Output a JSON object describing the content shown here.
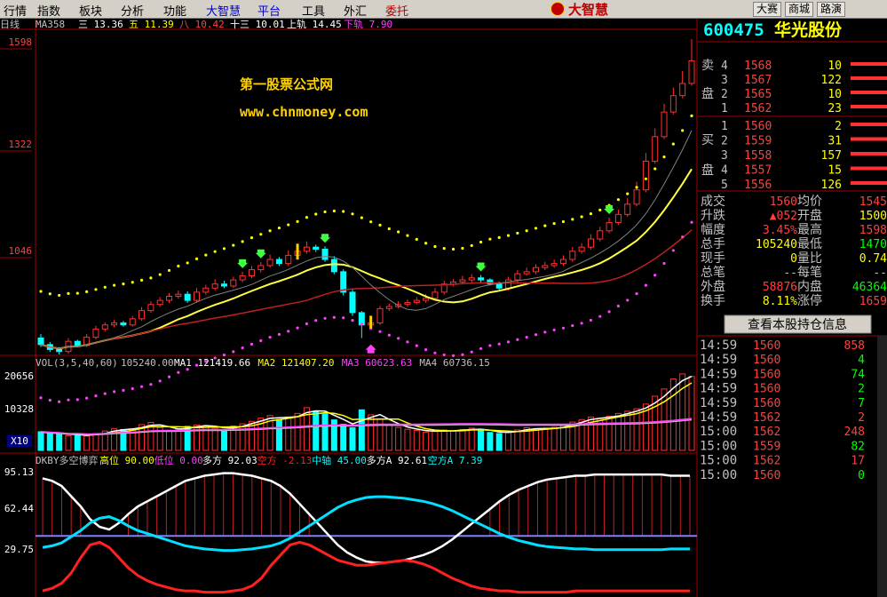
{
  "menu": {
    "items": [
      {
        "label": "行情",
        "x": 0,
        "style": "normal"
      },
      {
        "label": "指数",
        "x": 38,
        "style": "normal"
      },
      {
        "label": "板块",
        "x": 85,
        "style": "normal"
      },
      {
        "label": "分析",
        "x": 132,
        "style": "normal"
      },
      {
        "label": "功能",
        "x": 180,
        "style": "normal"
      },
      {
        "label": "大智慧",
        "x": 228,
        "style": "blue"
      },
      {
        "label": "平台",
        "x": 286,
        "style": "blue"
      },
      {
        "label": "工具",
        "x": 336,
        "style": "normal"
      },
      {
        "label": "外汇",
        "x": 383,
        "style": "normal"
      },
      {
        "label": "委托",
        "x": 430,
        "style": "red"
      }
    ],
    "brand": "大智慧",
    "buttons": [
      "大赛",
      "商城",
      "路演"
    ]
  },
  "chart_header": {
    "period": "日线",
    "ma_title": "MA358",
    "ma_items": [
      {
        "label": "三 13.36",
        "color": "#ffffff"
      },
      {
        "label": "五 11.39",
        "color": "#ffff00"
      },
      {
        "label": "八 10.42",
        "color": "#ff4040"
      },
      {
        "label": "十三 10.01",
        "color": "#ffffff"
      },
      {
        "label": "上轨 14.45",
        "color": "#ffffff"
      },
      {
        "label": "下轨 7.90",
        "color": "#ff40ff"
      }
    ]
  },
  "watermark": {
    "line1": "第一股票公式网",
    "line2": "www.chnmoney.com"
  },
  "price_axis": [
    {
      "label": "1598",
      "y": 47
    },
    {
      "label": "1322",
      "y": 162
    },
    {
      "label": "1046",
      "y": 282
    }
  ],
  "vol_header": {
    "title": "VOL(3,5,40,60)",
    "value": "105240.00",
    "ma": [
      {
        "label": "MA1 121419.66",
        "color": "#ffffff"
      },
      {
        "label": "MA2 121407.20",
        "color": "#ffff00"
      },
      {
        "label": "MA3 60623.63",
        "color": "#ff40ff"
      },
      {
        "label": "MA4 60736.15",
        "color": "#c0c0c0"
      }
    ]
  },
  "vol_axis": [
    {
      "label": "20656",
      "y": 427
    },
    {
      "label": "10328",
      "y": 464
    },
    {
      "label": "X10",
      "y": 500
    }
  ],
  "ind_header": {
    "title": "DKBY多空博弈",
    "items": [
      {
        "label": "高位 90.00",
        "color": "#ffff00"
      },
      {
        "label": "低位 0.00",
        "color": "#ff40ff"
      },
      {
        "label": "多方 92.03",
        "color": "#ffffff"
      },
      {
        "label": "空方 -2.13",
        "color": "#ff2020"
      },
      {
        "label": "中轴 45.00",
        "color": "#00ffff"
      },
      {
        "label": "多方A 92.61",
        "color": "#ffffff"
      },
      {
        "label": "空方A 7.39",
        "color": "#00ffff"
      }
    ]
  },
  "ind_axis": [
    {
      "label": "95.13",
      "y": 535
    },
    {
      "label": "62.44",
      "y": 576
    },
    {
      "label": "29.75",
      "y": 622
    }
  ],
  "stock": {
    "code": "600475",
    "name": "华光股份"
  },
  "sell_book": [
    {
      "n": "4",
      "price": "1568",
      "vol": "10"
    },
    {
      "n": "3",
      "price": "1567",
      "vol": "122"
    },
    {
      "n": "2",
      "price": "1565",
      "vol": "10"
    },
    {
      "n": "1",
      "price": "1562",
      "vol": "23"
    }
  ],
  "sell_label": [
    "卖",
    "盘"
  ],
  "buy_book": [
    {
      "n": "1",
      "price": "1560",
      "vol": "2"
    },
    {
      "n": "2",
      "price": "1559",
      "vol": "31"
    },
    {
      "n": "3",
      "price": "1558",
      "vol": "157"
    },
    {
      "n": "4",
      "price": "1557",
      "vol": "15"
    },
    {
      "n": "5",
      "price": "1556",
      "vol": "126"
    }
  ],
  "buy_label": [
    "买",
    "盘"
  ],
  "quote": [
    {
      "l1": "成交",
      "v1": "1560",
      "c1": "#ff4040",
      "l2": "均价",
      "v2": "1545",
      "c2": "#ff4040"
    },
    {
      "l1": "升跌",
      "v1": "▲052",
      "c1": "#ff4040",
      "l2": "开盘",
      "v2": "1500",
      "c2": "#ffff00"
    },
    {
      "l1": "幅度",
      "v1": "3.45%",
      "c1": "#ff4040",
      "l2": "最高",
      "v2": "1598",
      "c2": "#ff4040"
    },
    {
      "l1": "总手",
      "v1": "105240",
      "c1": "#ffff00",
      "l2": "最低",
      "v2": "1470",
      "c2": "#00ff00"
    },
    {
      "l1": "现手",
      "v1": "0",
      "c1": "#ffff00",
      "l2": "量比",
      "v2": "0.74",
      "c2": "#ffff00"
    },
    {
      "l1": "总笔",
      "v1": "--",
      "c1": "#c0c0c0",
      "l2": "每笔",
      "v2": "--",
      "c2": "#c0c0c0"
    },
    {
      "l1": "外盘",
      "v1": "58876",
      "c1": "#ff4040",
      "l2": "内盘",
      "v2": "46364",
      "c2": "#00ff00"
    },
    {
      "l1": "换手",
      "v1": "8.11%",
      "c1": "#ffff00",
      "l2": "涨停",
      "v2": "1659",
      "c2": "#ff4040"
    }
  ],
  "holdings_button": "查看本股持仓信息",
  "ticks": [
    {
      "time": "14:59",
      "price": "1560",
      "vol": "858",
      "vc": "#ff4040"
    },
    {
      "time": "14:59",
      "price": "1560",
      "vol": "4",
      "vc": "#00ff00"
    },
    {
      "time": "14:59",
      "price": "1560",
      "vol": "74",
      "vc": "#00ff00"
    },
    {
      "time": "14:59",
      "price": "1560",
      "vol": "2",
      "vc": "#00ff00"
    },
    {
      "time": "14:59",
      "price": "1560",
      "vol": "7",
      "vc": "#00ff00"
    },
    {
      "time": "14:59",
      "price": "1562",
      "vol": "2",
      "vc": "#ff4040"
    },
    {
      "time": "15:00",
      "price": "1562",
      "vol": "248",
      "vc": "#ff4040"
    },
    {
      "time": "15:00",
      "price": "1559",
      "vol": "82",
      "vc": "#00ff00"
    },
    {
      "time": "15:00",
      "price": "1562",
      "vol": "17",
      "vc": "#ff4040"
    },
    {
      "time": "15:00",
      "price": "1560",
      "vol": "0",
      "vc": "#00ff00"
    }
  ],
  "chart_data": [
    {
      "type": "candlestick",
      "name": "price",
      "y_ticks": [
        1046,
        1322,
        1598
      ],
      "ylim": [
        830,
        1620
      ],
      "open": [
        868,
        852,
        840,
        835,
        860,
        850,
        870,
        890,
        900,
        905,
        900,
        915,
        935,
        950,
        960,
        970,
        975,
        960,
        980,
        990,
        1000,
        995,
        1010,
        1020,
        1035,
        1045,
        1060,
        1050,
        1070,
        1080,
        1090,
        1085,
        1060,
        1030,
        980,
        930,
        900,
        905,
        940,
        945,
        950,
        955,
        960,
        965,
        980,
        1000,
        1005,
        1010,
        1015,
        1010,
        1000,
        990,
        1010,
        1025,
        1030,
        1040,
        1045,
        1050,
        1060,
        1080,
        1090,
        1110,
        1130,
        1150,
        1170,
        1195,
        1230,
        1300,
        1360,
        1420,
        1460,
        1490
      ],
      "close": [
        852,
        840,
        835,
        860,
        850,
        870,
        890,
        900,
        905,
        900,
        915,
        935,
        950,
        960,
        970,
        975,
        960,
        980,
        990,
        1000,
        995,
        1010,
        1020,
        1035,
        1045,
        1060,
        1050,
        1070,
        1080,
        1090,
        1085,
        1060,
        1030,
        980,
        930,
        900,
        905,
        940,
        945,
        950,
        955,
        960,
        965,
        980,
        1000,
        1005,
        1010,
        1015,
        1010,
        1000,
        990,
        1010,
        1025,
        1030,
        1040,
        1045,
        1050,
        1060,
        1080,
        1090,
        1110,
        1130,
        1150,
        1170,
        1195,
        1230,
        1300,
        1360,
        1420,
        1460,
        1490,
        1545
      ],
      "high": [
        878,
        858,
        846,
        868,
        864,
        878,
        898,
        906,
        912,
        910,
        922,
        944,
        958,
        968,
        978,
        984,
        982,
        990,
        998,
        1012,
        1008,
        1018,
        1030,
        1044,
        1054,
        1072,
        1066,
        1082,
        1094,
        1104,
        1096,
        1092,
        1068,
        1036,
        988,
        934,
        918,
        946,
        952,
        958,
        962,
        968,
        976,
        990,
        1008,
        1012,
        1020,
        1024,
        1022,
        1014,
        1006,
        1018,
        1034,
        1040,
        1048,
        1054,
        1060,
        1070,
        1090,
        1100,
        1122,
        1140,
        1162,
        1182,
        1210,
        1250,
        1320,
        1380,
        1440,
        1480,
        1520,
        1598
      ],
      "low": [
        846,
        834,
        828,
        830,
        846,
        846,
        864,
        884,
        894,
        896,
        896,
        910,
        930,
        944,
        954,
        964,
        954,
        954,
        974,
        984,
        990,
        990,
        1004,
        1014,
        1028,
        1040,
        1044,
        1044,
        1064,
        1074,
        1078,
        1054,
        1024,
        972,
        922,
        868,
        896,
        900,
        934,
        940,
        944,
        950,
        954,
        960,
        974,
        994,
        1000,
        1004,
        1004,
        996,
        984,
        984,
        1004,
        1020,
        1024,
        1034,
        1040,
        1044,
        1054,
        1074,
        1084,
        1104,
        1124,
        1144,
        1164,
        1190,
        1224,
        1294,
        1354,
        1414,
        1454,
        1484
      ]
    },
    {
      "type": "bar",
      "name": "volume",
      "y_ticks": [
        10328,
        20656
      ],
      "ylim": [
        0,
        23000
      ],
      "values": [
        5200,
        4800,
        4600,
        4100,
        4500,
        4000,
        4700,
        5400,
        6100,
        5800,
        6000,
        7200,
        7800,
        6400,
        5600,
        5900,
        6700,
        7100,
        6900,
        6200,
        5800,
        6800,
        7400,
        8100,
        9000,
        9700,
        8600,
        9300,
        10300,
        11900,
        10800,
        10100,
        8500,
        7300,
        6300,
        11300,
        9900,
        8700,
        7300,
        6400,
        5900,
        5600,
        5100,
        5300,
        5700,
        5400,
        5800,
        6200,
        5700,
        5000,
        4700,
        5300,
        5700,
        6300,
        6100,
        5900,
        6400,
        6900,
        7900,
        8600,
        9300,
        8900,
        9500,
        10300,
        10900,
        11600,
        12900,
        15100,
        17100,
        19900,
        21300,
        20600
      ]
    },
    {
      "type": "line",
      "name": "DKBY多空博弈",
      "y_ticks": [
        29.75,
        62.44,
        95.13
      ],
      "ylim": [
        0,
        100
      ],
      "series": [
        {
          "name": "多方",
          "values": [
            90,
            88,
            84,
            76,
            68,
            58,
            52,
            50,
            55,
            62,
            68,
            72,
            76,
            80,
            84,
            88,
            90,
            92,
            93,
            94,
            94,
            93,
            92,
            90,
            88,
            84,
            78,
            70,
            62,
            54,
            46,
            38,
            32,
            28,
            25,
            24,
            24,
            25,
            26,
            28,
            30,
            33,
            37,
            42,
            48,
            54,
            60,
            66,
            72,
            77,
            81,
            84,
            87,
            89,
            90,
            91,
            92,
            92,
            93,
            93,
            93,
            93,
            93,
            93,
            93,
            93,
            92,
            92,
            92
          ]
        },
        {
          "name": "空方",
          "values": [
            2,
            4,
            8,
            16,
            28,
            38,
            40,
            36,
            28,
            20,
            14,
            10,
            7,
            5,
            3,
            2,
            2,
            1,
            1,
            1,
            2,
            3,
            6,
            12,
            22,
            30,
            38,
            40,
            38,
            34,
            30,
            26,
            24,
            22,
            22,
            23,
            24,
            25,
            26,
            25,
            23,
            20,
            16,
            12,
            9,
            6,
            4,
            3,
            2,
            2,
            1,
            1,
            1,
            1,
            1,
            1,
            2,
            2,
            2,
            2,
            2,
            2,
            2,
            2,
            2,
            2,
            2,
            2,
            2
          ]
        },
        {
          "name": "中轴",
          "values": [
            45,
            45,
            45,
            45,
            45,
            45,
            45,
            45,
            45,
            45,
            45,
            45,
            45,
            45,
            45,
            45,
            45,
            45,
            45,
            45,
            45,
            45,
            45,
            45,
            45,
            45,
            45,
            45,
            45,
            45,
            45,
            45,
            45,
            45,
            45,
            45,
            45,
            45,
            45,
            45,
            45,
            45,
            45,
            45,
            45,
            45,
            45,
            45,
            45,
            45,
            45,
            45,
            45,
            45,
            45,
            45,
            45,
            45,
            45,
            45,
            45,
            45,
            45,
            45,
            45,
            45,
            45,
            45,
            45
          ]
        }
      ]
    }
  ]
}
